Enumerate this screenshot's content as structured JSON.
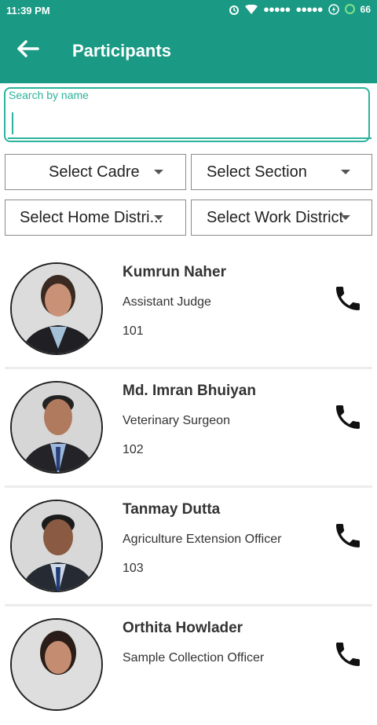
{
  "status": {
    "time": "11:39 PM",
    "battery": "66",
    "signal1": "●●●●●",
    "signal2": "●●●●●"
  },
  "appbar": {
    "title": "Participants"
  },
  "search": {
    "label": "Search by name"
  },
  "filters": {
    "cadre": "Select Cadre",
    "section": "Select Section",
    "home_district": "Select Home Distri...",
    "work_district": "Select Work District"
  },
  "participants": [
    {
      "name": "Kumrun Naher",
      "designation": "Assistant Judge",
      "code": "101"
    },
    {
      "name": "Md. Imran Bhuiyan",
      "designation": "Veterinary Surgeon",
      "code": "102"
    },
    {
      "name": "Tanmay Dutta",
      "designation": "Agriculture Extension Officer",
      "code": "103"
    },
    {
      "name": "Orthita Howlader",
      "designation": "Sample Collection Officer",
      "code": ""
    }
  ],
  "colors": {
    "primary": "#1a9a84",
    "accent": "#2bb39b",
    "icon": "#111111"
  },
  "icons": {
    "back": "arrow-left-icon",
    "call": "phone-icon",
    "alarm": "alarm-icon",
    "wifi": "wifi-icon"
  }
}
